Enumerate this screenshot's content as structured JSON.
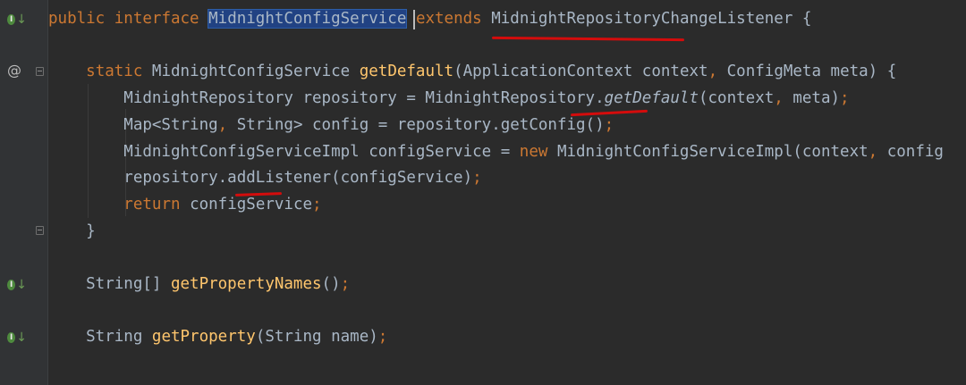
{
  "editor": {
    "lines": [
      {
        "tokens": [
          {
            "t": "public ",
            "c": "kw"
          },
          {
            "t": "interface ",
            "c": "kw"
          },
          {
            "t": "MidnightConfigService",
            "c": "hl"
          },
          {
            "t": " "
          },
          {
            "t": "extends ",
            "c": "kw"
          },
          {
            "t": "MidnightRepositoryChangeListener"
          },
          {
            "t": " {"
          }
        ]
      },
      {
        "tokens": []
      },
      {
        "tokens": [
          {
            "t": "    "
          },
          {
            "t": "static ",
            "c": "kw"
          },
          {
            "t": "MidnightConfigService "
          },
          {
            "t": "getDefault",
            "c": "fn"
          },
          {
            "t": "(ApplicationContext context"
          },
          {
            "t": ", ",
            "c": "kw"
          },
          {
            "t": "ConfigMeta meta) {"
          }
        ]
      },
      {
        "tokens": [
          {
            "t": "        MidnightRepository repository = MidnightRepository."
          },
          {
            "t": "getDefault",
            "c": "it"
          },
          {
            "t": "(context"
          },
          {
            "t": ", ",
            "c": "kw"
          },
          {
            "t": "meta)"
          },
          {
            "t": ";",
            "c": "kw"
          }
        ]
      },
      {
        "tokens": [
          {
            "t": "        Map<String"
          },
          {
            "t": ", ",
            "c": "kw"
          },
          {
            "t": "String> config = repository.getConfig()"
          },
          {
            "t": ";",
            "c": "kw"
          }
        ]
      },
      {
        "tokens": [
          {
            "t": "        MidnightConfigServiceImpl configService = "
          },
          {
            "t": "new ",
            "c": "kw"
          },
          {
            "t": "MidnightConfigServiceImpl(context"
          },
          {
            "t": ", ",
            "c": "kw"
          },
          {
            "t": "config"
          }
        ]
      },
      {
        "tokens": [
          {
            "t": "        repository.addListener(configService)"
          },
          {
            "t": ";",
            "c": "kw"
          }
        ]
      },
      {
        "tokens": [
          {
            "t": "        "
          },
          {
            "t": "return ",
            "c": "kw"
          },
          {
            "t": "configService"
          },
          {
            "t": ";",
            "c": "kw"
          }
        ]
      },
      {
        "tokens": [
          {
            "t": "    }"
          }
        ]
      },
      {
        "tokens": []
      },
      {
        "tokens": [
          {
            "t": "    String[] "
          },
          {
            "t": "getPropertyNames",
            "c": "fn"
          },
          {
            "t": "()"
          },
          {
            "t": ";",
            "c": "kw"
          }
        ]
      },
      {
        "tokens": []
      },
      {
        "tokens": [
          {
            "t": "    String "
          },
          {
            "t": "getProperty",
            "c": "fn"
          },
          {
            "t": "(String name)"
          },
          {
            "t": ";",
            "c": "kw"
          }
        ]
      }
    ]
  },
  "gutter": {
    "implemented_icon": "implementing-method-icon",
    "implemented_glyph": "I",
    "arrow_glyph": "↓",
    "override_glyph": "@",
    "fold_icon": "fold-icon"
  },
  "colors": {
    "background": "#2b2b2b",
    "keyword": "#cc7832",
    "function": "#ffc66d",
    "text": "#a9b7c6",
    "selection": "#214283",
    "annotation_marker": "#d40c0c"
  }
}
